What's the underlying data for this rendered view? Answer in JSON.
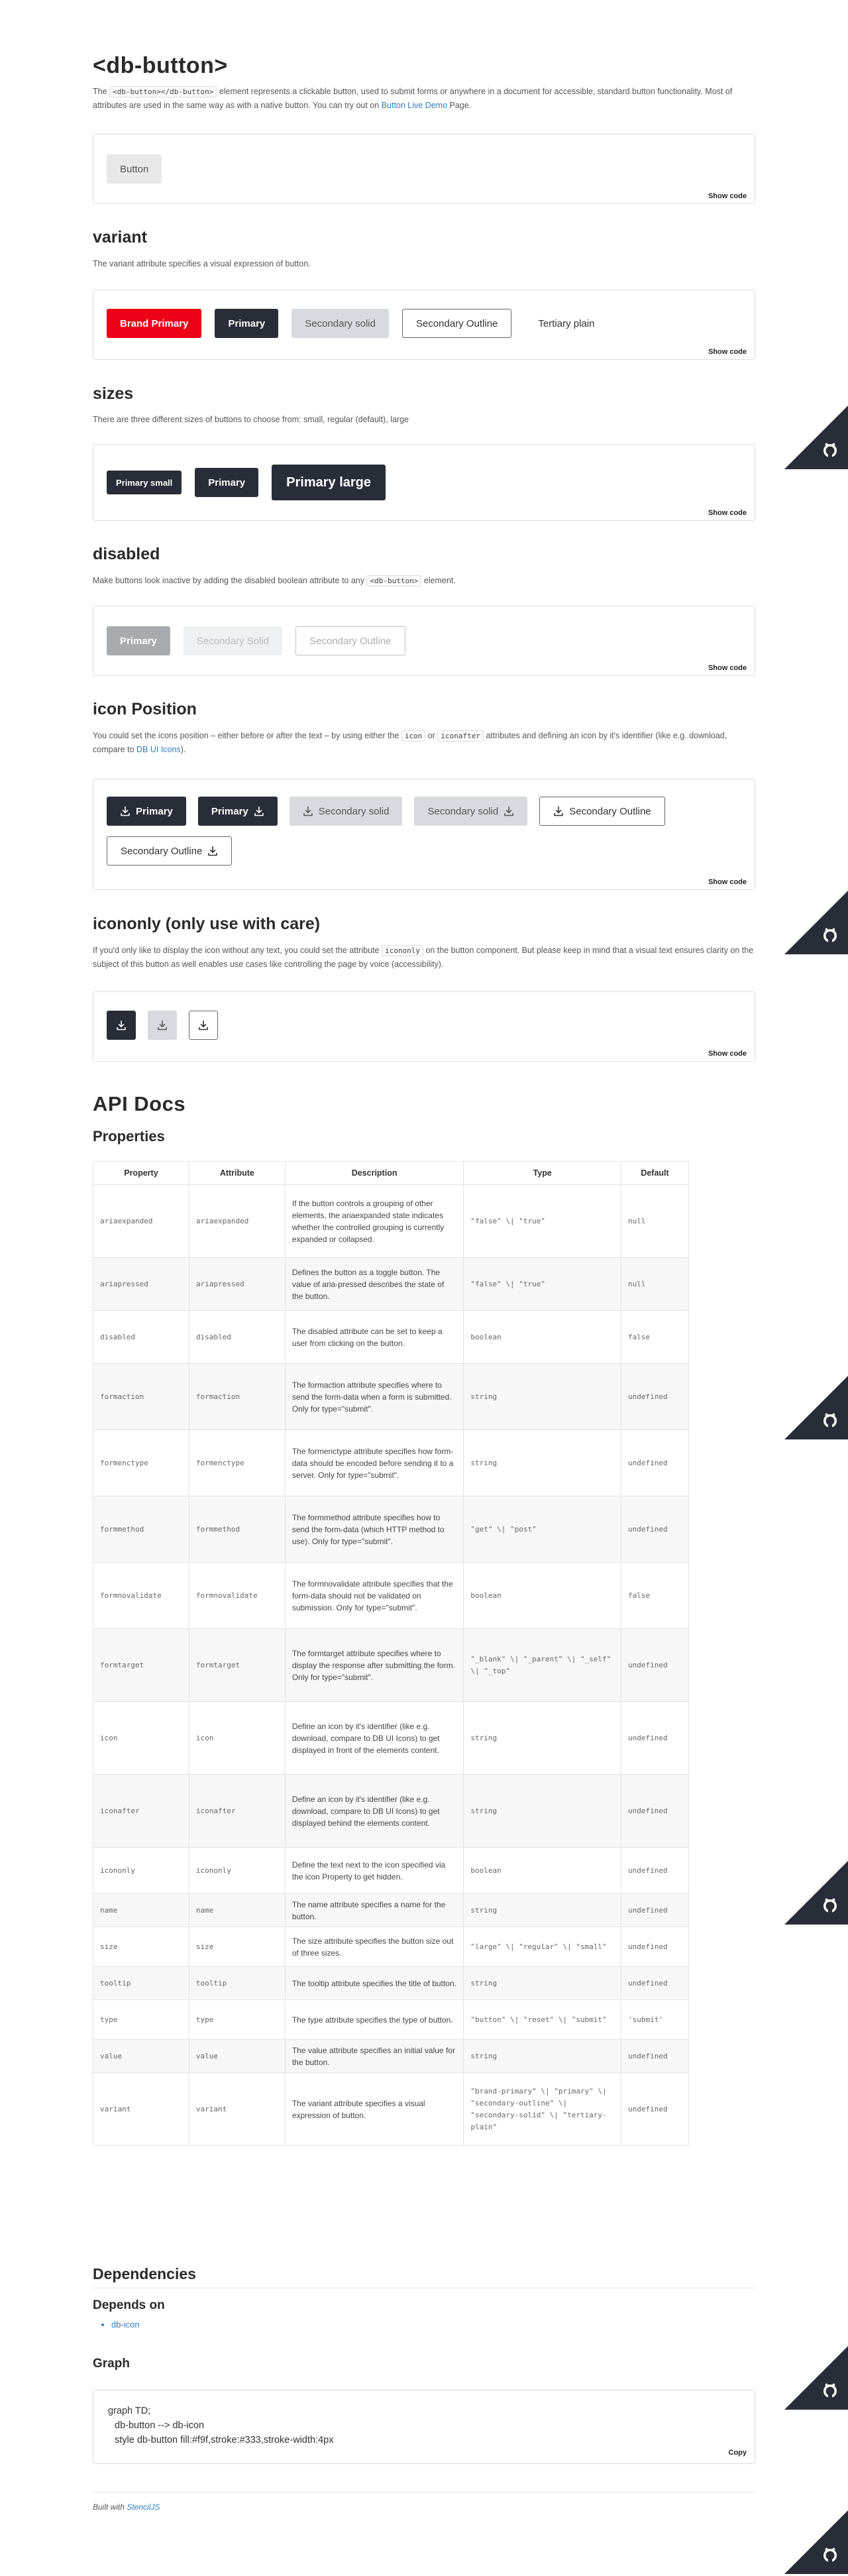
{
  "intro": {
    "title": "<db-button>",
    "desc_pre": "The ",
    "desc_code": "<db-button></db-button>",
    "desc_mid": " element represents a clickable button, used to submit forms or anywhere in a document for accessible, standard button functionality. Most of attributes are used in the same way as with a native button. You can try out on ",
    "desc_link": "Button Live Demo",
    "desc_post": " Page.",
    "button": "Button",
    "show_code": "Show code"
  },
  "variant": {
    "title": "variant",
    "desc": "The variant attribute specifies a visual expression of button.",
    "buttons": [
      "Brand Primary",
      "Primary",
      "Secondary solid",
      "Secondary Outline",
      "Tertiary plain"
    ],
    "show_code": "Show code"
  },
  "sizes": {
    "title": "sizes",
    "desc": "There are three different sizes of buttons to choose from: small, regular (default), large",
    "buttons": [
      "Primary small",
      "Primary",
      "Primary large"
    ],
    "show_code": "Show code"
  },
  "disabled": {
    "title": "disabled",
    "desc_pre": "Make buttons look inactive by adding the disabled boolean attribute to any ",
    "desc_code": "<db-button>",
    "desc_post": " element.",
    "buttons": [
      "Primary",
      "Secondary Solid",
      "Secondary Outline"
    ],
    "show_code": "Show code"
  },
  "icon_position": {
    "title": "icon Position",
    "desc_1": "You could set the icons position – either before or after the text – by using either the ",
    "code_1": "icon",
    "desc_2": " or ",
    "code_2": "iconafter",
    "desc_3": " attributes and defining an icon by it's identifier (like e.g. download, compare to ",
    "desc_link": "DB UI Icons",
    "desc_4": ").",
    "buttons": [
      "Primary",
      "Primary",
      "Secondary solid",
      "Secondary solid",
      "Secondary Outline",
      "Secondary Outline"
    ],
    "show_code": "Show code"
  },
  "icononly": {
    "title": "icononly (only use with care)",
    "desc_1": "If you'd only like to display the icon without any text, you could set the attribute ",
    "code": "icononly",
    "desc_2": " on the button component. But please keep in mind that a visual text ensures clarity on the subject of this button as well enables use cases like controlling the page by voice (accessibility).",
    "show_code": "Show code",
    "icon": "download-icon"
  },
  "api": {
    "title": "API Docs",
    "properties_title": "Properties",
    "headers": [
      "Property",
      "Attribute",
      "Description",
      "Type",
      "Default"
    ],
    "rows": [
      [
        "ariaexpanded",
        "ariaexpanded",
        "If the button controls a grouping of other elements, the ariaexpanded state indicates whether the controlled grouping is currently expanded or collapsed.",
        "\"false\" \\| \"true\"",
        "null"
      ],
      [
        "ariapressed",
        "ariapressed",
        "Defines the button as a toggle button. The value of aria-pressed describes the state of the button.",
        "\"false\" \\| \"true\"",
        "null"
      ],
      [
        "disabled",
        "disabled",
        "The disabled attribute can be set to keep a user from clicking on the button.",
        "boolean",
        "false"
      ],
      [
        "formaction",
        "formaction",
        "The formaction attribute specifies where to send the form-data when a form is submitted. Only for type=\"submit\".",
        "string",
        "undefined"
      ],
      [
        "formenctype",
        "formenctype",
        "The formenctype attribute specifies how form-data should be encoded before sending it to a server. Only for type=\"submit\".",
        "string",
        "undefined"
      ],
      [
        "formmethod",
        "formmethod",
        "The formmethod attribute specifies how to send the form-data (which HTTP method to use). Only for type=\"submit\".",
        "\"get\" \\| \"post\"",
        "undefined"
      ],
      [
        "formnovalidate",
        "formnovalidate",
        "The formnovalidate attribute specifies that the form-data should not be validated on submission. Only for type=\"submit\".",
        "boolean",
        "false"
      ],
      [
        "formtarget",
        "formtarget",
        "The formtarget attribute specifies where to display the response after submitting the form. Only for type=\"submit\".",
        "\"_blank\" \\| \"_parent\" \\| \"_self\" \\| \"_top\"",
        "undefined"
      ],
      [
        "icon",
        "icon",
        "Define an icon by it's identifier (like e.g. download, compare to DB UI Icons) to get displayed in front of the elements content.",
        "string",
        "undefined"
      ],
      [
        "iconafter",
        "iconafter",
        "Define an icon by it's identifier (like e.g. download, compare to DB UI Icons) to get displayed behind the elements content.",
        "string",
        "undefined"
      ],
      [
        "icononly",
        "icononly",
        "Define the text next to the icon specified via the icon Property to get hidden.",
        "boolean",
        "undefined"
      ],
      [
        "name",
        "name",
        "The name attribute specifies a name for the button.",
        "string",
        "undefined"
      ],
      [
        "size",
        "size",
        "The size attribute specifies the button size out of three sizes.",
        "\"large\" \\| \"regular\" \\| \"small\"",
        "undefined"
      ],
      [
        "tooltip",
        "tooltip",
        "The tooltip attribute specifies the title of button.",
        "string",
        "undefined"
      ],
      [
        "type",
        "type",
        "The type attribute specifies the type of button.",
        "\"button\" \\| \"reset\" \\| \"submit\"",
        "'submit'"
      ],
      [
        "value",
        "value",
        "The value attribute specifies an initial value for the button.",
        "string",
        "undefined"
      ],
      [
        "variant",
        "variant",
        "The variant attribute specifies a visual expression of button.",
        "\"brand-primary\" \\| \"primary\" \\| \"secondary-outline\" \\| \"secondary-solid\" \\| \"tertiary-plain\"",
        "undefined"
      ]
    ]
  },
  "dependencies": {
    "title": "Dependencies",
    "depends_on_title": "Depends on",
    "depends_on": [
      "db-icon"
    ],
    "graph_title": "Graph",
    "graph_lines": [
      "graph TD;",
      "db-button --> db-icon",
      "style db-button fill:#f9f,stroke:#333,stroke-width:4px"
    ],
    "copy": "Copy"
  },
  "footer": {
    "built_with": "Built with ",
    "link": "StencilJS"
  },
  "colors": {
    "brand": "#ec0016",
    "primary": "#282d37",
    "link": "#2d7fc2"
  }
}
